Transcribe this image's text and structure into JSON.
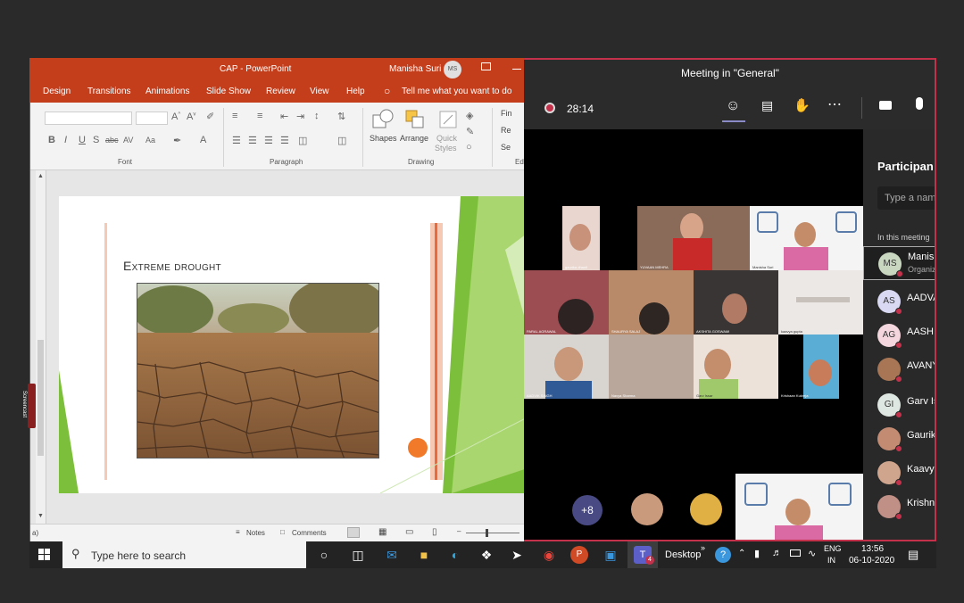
{
  "powerpoint": {
    "title": "CAP  -  PowerPoint",
    "user": "Manisha Suri",
    "user_initials": "MS",
    "tabs": [
      "Design",
      "Transitions",
      "Animations",
      "Slide Show",
      "Review",
      "View",
      "Help"
    ],
    "tell_me": "Tell me what you want to do",
    "groups": {
      "font": "Font",
      "paragraph": "Paragraph",
      "drawing": "Drawing",
      "editing": "Ed"
    },
    "drawing_tools": {
      "shapes": "Shapes",
      "arrange": "Arrange",
      "quick_styles_1": "Quick",
      "quick_styles_2": "Styles"
    },
    "editing_tools": [
      "Fin",
      "Re",
      "Se"
    ],
    "font_buttons": [
      "B",
      "I",
      "U",
      "S",
      "abc",
      "AV",
      "Aa",
      "A"
    ],
    "slide": {
      "title": "Extreme drought"
    },
    "status": {
      "left": "a)",
      "notes": "Notes",
      "comments": "Comments"
    },
    "side_tab": "Screencast"
  },
  "teams": {
    "title": "Meeting in \"General\"",
    "timer": "28:14",
    "participants_heading": "Participan",
    "search_placeholder": "Type a nam",
    "section": "In this meeting",
    "participants": [
      {
        "initials": "MS",
        "name": "Manis",
        "role": "Organiz",
        "color": "#c9d6c0"
      },
      {
        "initials": "AS",
        "name": "AADVA",
        "color": "#d9d9f3"
      },
      {
        "initials": "AG",
        "name": "AASHI",
        "color": "#f3d6de"
      },
      {
        "initials": "",
        "name": "AVANY",
        "color": "#a87654"
      },
      {
        "initials": "GI",
        "name": "Garv Is",
        "color": "#dfe7e2"
      },
      {
        "initials": "",
        "name": "Gaurik",
        "color": "#c48b73"
      },
      {
        "initials": "",
        "name": "Kaavya",
        "color": "#cfa58e"
      },
      {
        "initials": "",
        "name": "Krishn",
        "color": "#c08f86"
      }
    ],
    "more_count": "+8",
    "tiles": [
      {
        "name": "gaurika dhanil"
      },
      {
        "name": "YUVAAN MEHRA"
      },
      {
        "name": "Manisha Suri"
      },
      {
        "name": "PARAL AGRAWAL"
      },
      {
        "name": "SHAURYA SALAJ"
      },
      {
        "name": "AKSHITA GOSWAMI"
      },
      {
        "name": "kaavya gupta"
      },
      {
        "name": "AADVIK SINGH"
      },
      {
        "name": "Navya Sharma"
      },
      {
        "name": "Garv Issar"
      },
      {
        "name": "Krishaan Kukreja"
      }
    ]
  },
  "taskbar": {
    "search_placeholder": "Type here to search",
    "desktop": "Desktop",
    "lang_1": "ENG",
    "lang_2": "IN",
    "time": "13:56",
    "date": "06-10-2020",
    "teams_badge": "4"
  }
}
